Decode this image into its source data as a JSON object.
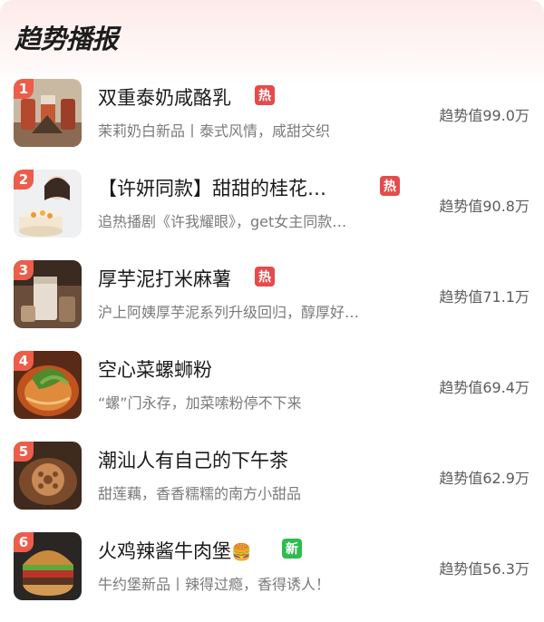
{
  "header": {
    "title": "趋势播报"
  },
  "colors": {
    "rank": "#ec5d4a",
    "hot": "#e54b4b",
    "new": "#2ebc4f"
  },
  "items": [
    {
      "rank": "1",
      "name": "双重泰奶咸酪乳",
      "badge": "热",
      "badge_type": "hot",
      "desc": "茉莉奶白新品丨泰式风情，咸甜交织",
      "score": "趋势值99.0万",
      "image": "thai-milk-tea-drinks"
    },
    {
      "rank": "2",
      "name": "【许妍同款】甜甜的桂花…",
      "badge": "热",
      "badge_type": "hot",
      "desc": "追热播剧《许我耀眼》，get女主同款…",
      "score": "趋势值90.8万",
      "image": "osmanthus-cake-photo"
    },
    {
      "rank": "3",
      "name": "厚芋泥打米麻薯",
      "badge": "热",
      "badge_type": "hot",
      "desc": "沪上阿姨厚芋泥系列升级回归，醇厚好…",
      "score": "趋势值71.1万",
      "image": "taro-mochi-drink"
    },
    {
      "rank": "4",
      "name": "空心菜螺蛳粉",
      "badge": "",
      "badge_type": "",
      "desc": "“螺”门永存，加菜嗦粉停不下来",
      "score": "趋势值69.4万",
      "image": "luosifen-noodles"
    },
    {
      "rank": "5",
      "name": "潮汕人有自己的下午茶",
      "badge": "",
      "badge_type": "",
      "desc": "甜莲藕，香香糯糯的南方小甜品",
      "score": "趋势值62.9万",
      "image": "sweet-lotus-root"
    },
    {
      "rank": "6",
      "name": "火鸡辣酱牛肉堡",
      "emoji": "🍔",
      "badge": "新",
      "badge_type": "new",
      "desc": "牛约堡新品丨辣得过瘾，香得诱人！",
      "score": "趋势值56.3万",
      "image": "beef-burger"
    }
  ]
}
